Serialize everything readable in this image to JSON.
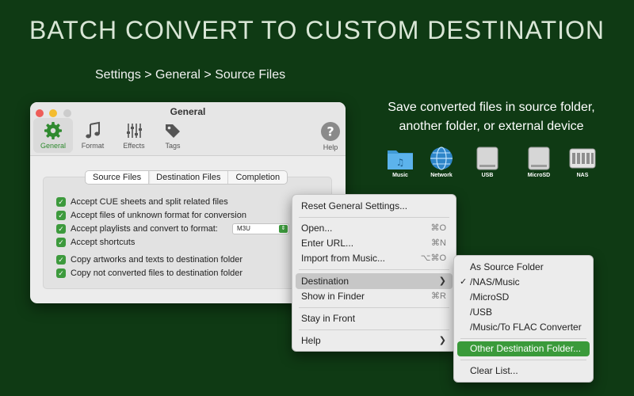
{
  "headline": "BATCH CONVERT TO CUSTOM DESTINATION",
  "breadcrumb": "Settings > General > Source Files",
  "caption": {
    "line1": "Save converted files in source folder,",
    "line2": "another folder, or external device"
  },
  "devices": [
    {
      "label": "Music",
      "icon": "music-folder-icon"
    },
    {
      "label": "Network",
      "icon": "network-globe-icon"
    },
    {
      "label": "USB",
      "icon": "usb-drive-icon"
    },
    {
      "label": "MicroSD",
      "icon": "microsd-drive-icon"
    },
    {
      "label": "NAS",
      "icon": "nas-server-icon"
    }
  ],
  "window": {
    "title": "General",
    "toolbar": [
      {
        "label": "General",
        "icon": "gear-icon",
        "active": true
      },
      {
        "label": "Format",
        "icon": "music-note-icon"
      },
      {
        "label": "Effects",
        "icon": "sliders-icon"
      },
      {
        "label": "Tags",
        "icon": "tags-icon"
      },
      {
        "label": "Help",
        "icon": "help-icon"
      }
    ],
    "tabs": [
      "Source Files",
      "Destination Files",
      "Completion"
    ],
    "options": [
      "Accept CUE sheets and split related files",
      "Accept files of unknown format for conversion",
      "Accept playlists and convert to format:",
      "Accept shortcuts",
      "Copy artworks and texts to destination folder",
      "Copy not converted files to destination folder"
    ],
    "playlist_format": "M3U",
    "accent": "#3d9a3d"
  },
  "menu": {
    "items": [
      {
        "label": "Reset General Settings...",
        "shortcut": ""
      },
      {
        "label": "Open...",
        "shortcut": "⌘O"
      },
      {
        "label": "Enter URL...",
        "shortcut": "⌘N"
      },
      {
        "label": "Import from Music...",
        "shortcut": "⌥⌘O"
      },
      {
        "label": "Destination",
        "shortcut": ""
      },
      {
        "label": "Show in Finder",
        "shortcut": "⌘R"
      },
      {
        "label": "Stay in Front",
        "shortcut": ""
      },
      {
        "label": "Help",
        "shortcut": ""
      }
    ]
  },
  "submenu": {
    "items": [
      {
        "label": "As Source Folder",
        "checked": false
      },
      {
        "label": "/NAS/Music",
        "checked": true
      },
      {
        "label": "/MicroSD",
        "checked": false
      },
      {
        "label": "/USB",
        "checked": false
      },
      {
        "label": "/Music/To FLAC Converter",
        "checked": false
      },
      {
        "label": "Other Destination Folder...",
        "checked": false
      },
      {
        "label": "Clear List...",
        "checked": false
      }
    ],
    "checkmark": "✓",
    "selected_color": "#3a9a3a"
  }
}
